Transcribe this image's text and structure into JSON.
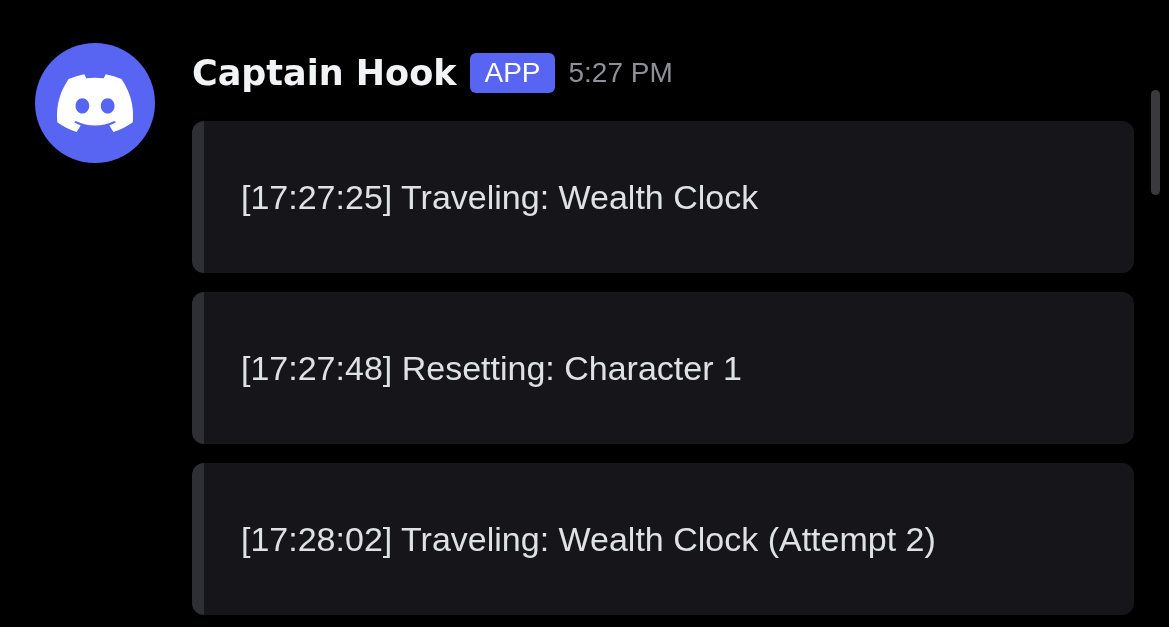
{
  "message": {
    "author": "Captain Hook",
    "badge": "APP",
    "time": "5:27 PM",
    "embeds": [
      {
        "text": "[17:27:25] Traveling: Wealth Clock"
      },
      {
        "text": "[17:27:48] Resetting: Character 1"
      },
      {
        "text": "[17:28:02] Traveling: Wealth Clock (Attempt 2)"
      }
    ]
  }
}
